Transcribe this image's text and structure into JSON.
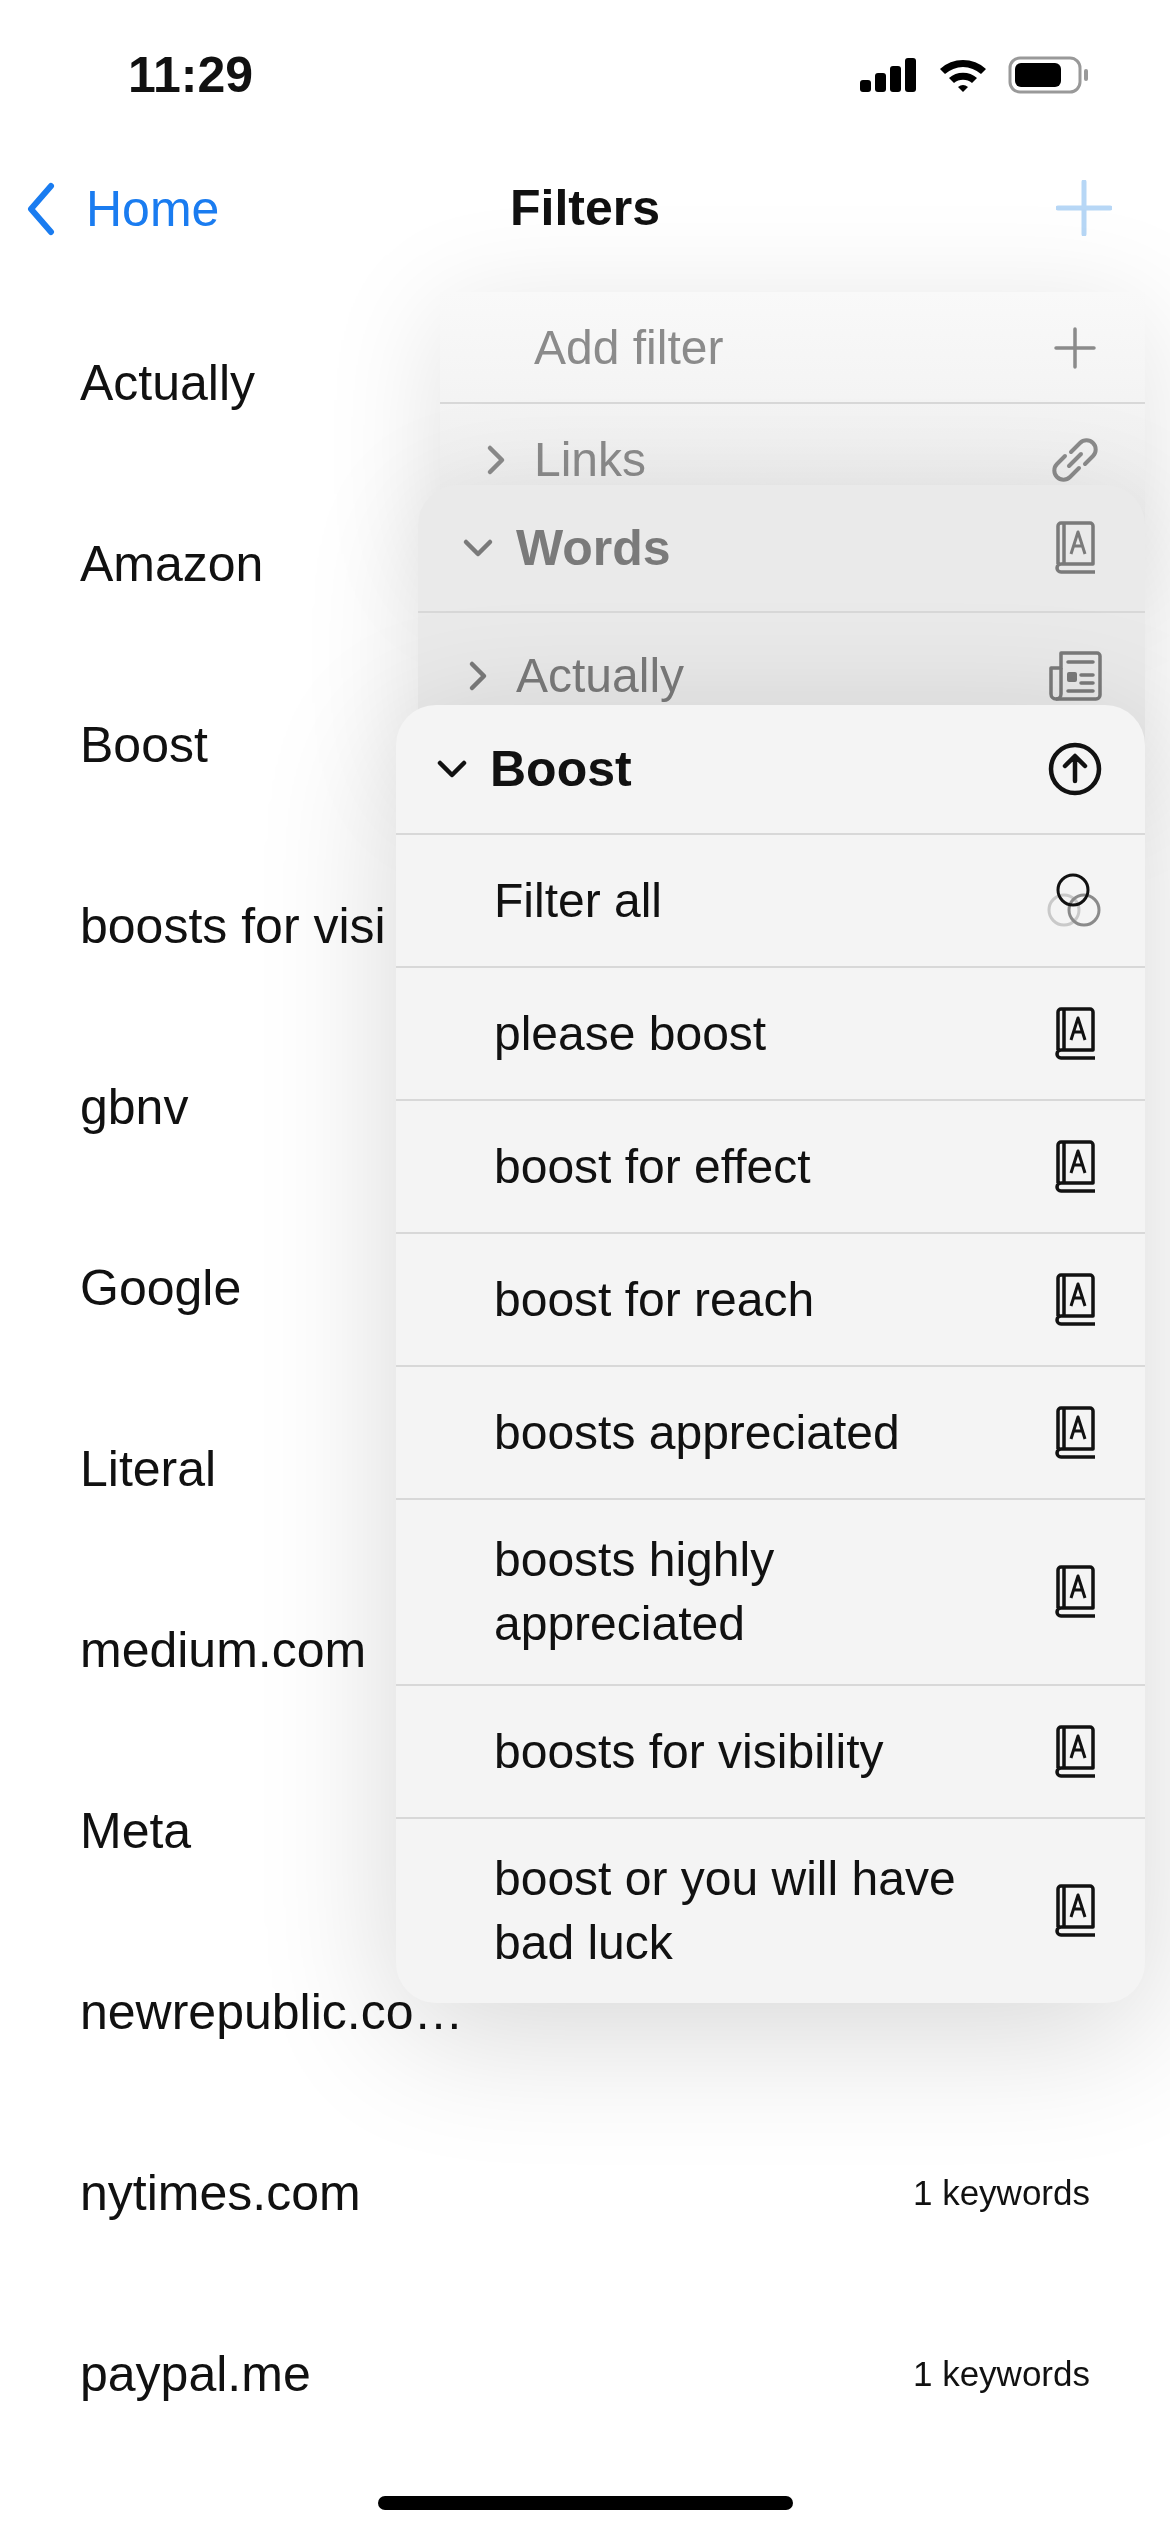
{
  "status_bar": {
    "time": "11:29"
  },
  "nav": {
    "back": "Home",
    "title": "Filters"
  },
  "list": [
    {
      "name": "Actually"
    },
    {
      "name": "Amazon"
    },
    {
      "name": "Boost"
    },
    {
      "name": "boosts for visi"
    },
    {
      "name": "gbnv"
    },
    {
      "name": "Google"
    },
    {
      "name": "Literal"
    },
    {
      "name": "medium.com"
    },
    {
      "name": "Meta"
    },
    {
      "name": "newrepublic.co…"
    },
    {
      "name": "nytimes.com",
      "detail": "1 keywords"
    },
    {
      "name": "paypal.me",
      "detail": "1 keywords"
    }
  ],
  "menus": [
    {
      "items": [
        {
          "kind": "add",
          "label": "Add filter"
        },
        {
          "kind": "link-group",
          "label": "Links",
          "expanded": false
        }
      ]
    },
    {
      "items": [
        {
          "kind": "word-group",
          "label": "Words",
          "expanded": true
        },
        {
          "kind": "source-group",
          "label": "Actually",
          "expanded": false
        }
      ]
    },
    {
      "items": [
        {
          "kind": "boost-group",
          "label": "Boost",
          "expanded": true
        },
        {
          "kind": "filter-all",
          "label": "Filter all"
        },
        {
          "kind": "word",
          "label": "please boost"
        },
        {
          "kind": "word",
          "label": "boost for effect"
        },
        {
          "kind": "word",
          "label": "boost for reach"
        },
        {
          "kind": "word",
          "label": "boosts appreciated"
        },
        {
          "kind": "word",
          "label": "boosts highly appreciated"
        },
        {
          "kind": "word",
          "label": "boosts for visibility"
        },
        {
          "kind": "word",
          "label": "boost or you will have bad luck"
        }
      ]
    }
  ]
}
